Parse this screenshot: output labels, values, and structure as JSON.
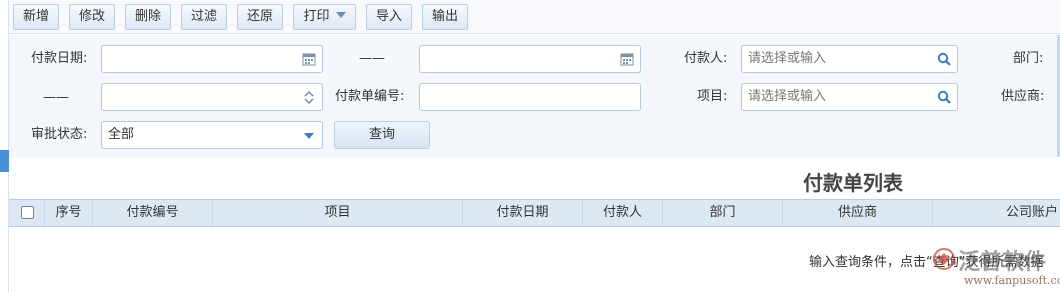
{
  "toolbar": {
    "buttons": [
      "新增",
      "修改",
      "删除",
      "过滤",
      "还原",
      "打印",
      "导入",
      "输出"
    ]
  },
  "form": {
    "pay_date_label": "付款日期:",
    "range_dash": "——",
    "payer_label": "付款人:",
    "payer_placeholder": "请选择或输入",
    "dept_label": "部门:",
    "number_dash": "——",
    "bill_no_label": "付款单编号:",
    "project_label": "项目:",
    "project_placeholder": "请选择或输入",
    "supplier_label": "供应商:",
    "approval_label": "审批状态:",
    "approval_value": "全部",
    "query_button": "查询"
  },
  "grid": {
    "title": "付款单列表",
    "columns": [
      "序号",
      "付款编号",
      "项目",
      "付款日期",
      "付款人",
      "部门",
      "供应商",
      "公司账户"
    ],
    "empty_hint": "输入查询条件，点击“查询”获得所需数据"
  },
  "watermark": {
    "brand": "泛普软件",
    "url": "www.fanpusoft.com"
  },
  "colors": {
    "accent": "#4a90d9",
    "header_bg": "#dde8f5",
    "form_bg": "#f4f7fb"
  }
}
